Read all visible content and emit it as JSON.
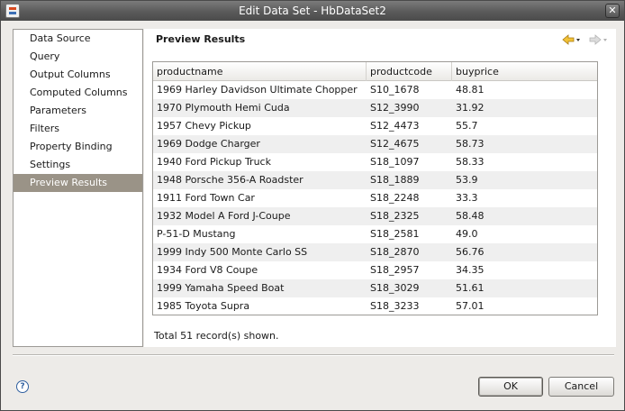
{
  "window": {
    "title": "Edit Data Set - HbDataSet2",
    "close_glyph": "✕"
  },
  "nav": {
    "items": [
      {
        "label": "Data Source",
        "selected": false
      },
      {
        "label": "Query",
        "selected": false
      },
      {
        "label": "Output Columns",
        "selected": false
      },
      {
        "label": "Computed Columns",
        "selected": false
      },
      {
        "label": "Parameters",
        "selected": false
      },
      {
        "label": "Filters",
        "selected": false
      },
      {
        "label": "Property Binding",
        "selected": false
      },
      {
        "label": "Settings",
        "selected": false
      },
      {
        "label": "Preview Results",
        "selected": true
      }
    ]
  },
  "main": {
    "title": "Preview Results",
    "icons": {
      "back": "arrow-left-icon",
      "forward": "arrow-right-icon"
    }
  },
  "table": {
    "columns": [
      "productname",
      "productcode",
      "buyprice"
    ],
    "rows": [
      [
        "1969 Harley Davidson Ultimate Chopper",
        "S10_1678",
        "48.81"
      ],
      [
        "1970 Plymouth Hemi Cuda",
        "S12_3990",
        "31.92"
      ],
      [
        "1957 Chevy Pickup",
        "S12_4473",
        "55.7"
      ],
      [
        "1969 Dodge Charger",
        "S12_4675",
        "58.73"
      ],
      [
        "1940 Ford Pickup Truck",
        "S18_1097",
        "58.33"
      ],
      [
        "1948 Porsche 356-A Roadster",
        "S18_1889",
        "53.9"
      ],
      [
        "1911 Ford Town Car",
        "S18_2248",
        "33.3"
      ],
      [
        "1932 Model A Ford J-Coupe",
        "S18_2325",
        "58.48"
      ],
      [
        "P-51-D Mustang",
        "S18_2581",
        "49.0"
      ],
      [
        "1999 Indy 500 Monte Carlo SS",
        "S18_2870",
        "56.76"
      ],
      [
        "1934 Ford V8 Coupe",
        "S18_2957",
        "34.35"
      ],
      [
        "1999 Yamaha Speed Boat",
        "S18_3029",
        "51.61"
      ],
      [
        "1985 Toyota Supra",
        "S18_3233",
        "57.01"
      ]
    ],
    "footer": "Total 51 record(s) shown."
  },
  "buttons": {
    "ok": "OK",
    "cancel": "Cancel",
    "help_glyph": "?"
  },
  "colors": {
    "selected_nav": "#9a9387",
    "titlebar": "#5a5a5a",
    "stripe": "#efefef"
  }
}
